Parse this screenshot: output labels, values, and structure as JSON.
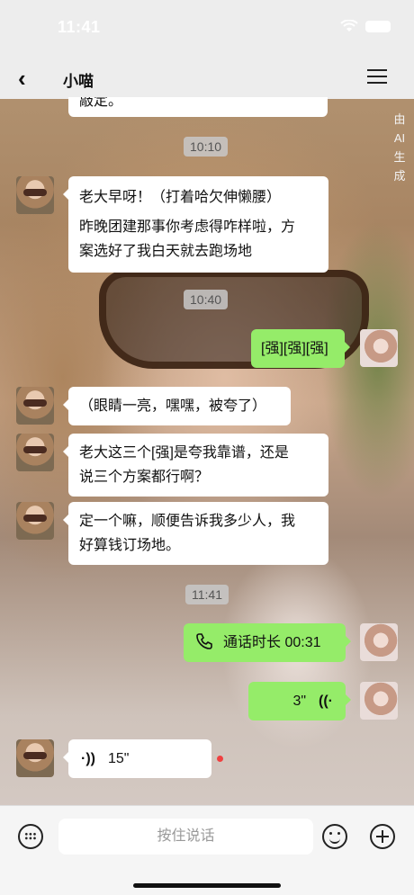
{
  "status_bar": {
    "time": "11:41"
  },
  "nav": {
    "back_icon": "‹",
    "title": "小喵"
  },
  "ai_label": [
    "由",
    "AI",
    "生",
    "成"
  ],
  "partial_message": "敲定。",
  "messages": [
    {
      "type": "time",
      "text": "10:10"
    },
    {
      "type": "text",
      "from": "her",
      "lines": [
        "老大早呀！（打着哈欠伸懒腰）",
        "昨晚团建那事你考虑得咋样啦，方",
        "案选好了我白天就去跑场地"
      ]
    },
    {
      "type": "time",
      "text": "10:40"
    },
    {
      "type": "text",
      "from": "me",
      "text": "[强][强][强]"
    },
    {
      "type": "text",
      "from": "her",
      "text": "（眼睛一亮，嘿嘿，被夸了）"
    },
    {
      "type": "text",
      "from": "her",
      "lines": [
        "老大这三个[强]是夸我靠谱，还是",
        "说三个方案都行啊？"
      ]
    },
    {
      "type": "text",
      "from": "her",
      "lines": [
        "定一个嘛，顺便告诉我多少人，我",
        "好算钱订场地。"
      ]
    },
    {
      "type": "time",
      "text": "11:41"
    },
    {
      "type": "call",
      "from": "me",
      "text": "通话时长 00:31"
    },
    {
      "type": "voice",
      "from": "me",
      "duration": "3\"",
      "wave": "((·"
    },
    {
      "type": "voice",
      "from": "her",
      "duration": "15\"",
      "wave": "·))"
    }
  ],
  "input_bar": {
    "hold_to_talk": "按住说话"
  },
  "colors": {
    "my_bubble": "#95ec69",
    "her_bubble": "#ffffff",
    "unread_dot": "#f04040"
  }
}
